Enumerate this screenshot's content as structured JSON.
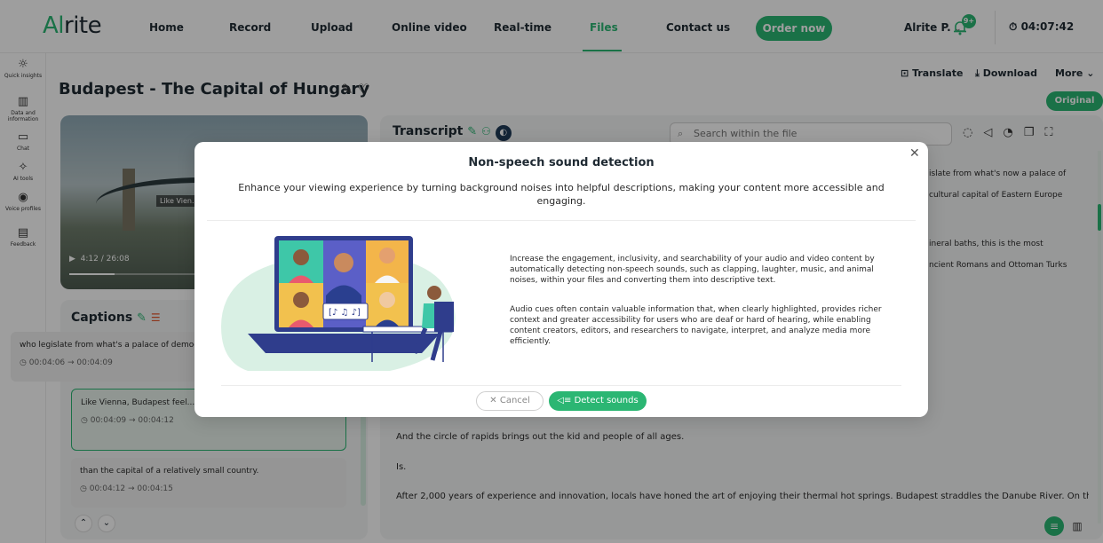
{
  "app": {
    "logo_a": "Al",
    "logo_b": "rite"
  },
  "nav": {
    "items": [
      "Home",
      "Record",
      "Upload",
      "Online video",
      "Real-time",
      "Files",
      "Contact us"
    ],
    "active": "Files",
    "order_label": "Order now",
    "user": "Alrite P.",
    "notif_count": "9+",
    "timer": "04:07:42"
  },
  "rail": [
    {
      "icon": "lightbulb-icon",
      "label": "Quick insights"
    },
    {
      "icon": "bar-chart-icon",
      "label": "Data and information"
    },
    {
      "icon": "chat-icon",
      "label": "Chat"
    },
    {
      "icon": "sparkle-icon",
      "label": "AI tools"
    },
    {
      "icon": "voice-icon",
      "label": "Voice profiles"
    },
    {
      "icon": "feedback-icon",
      "label": "Feedback"
    }
  ],
  "page": {
    "title": "Budapest - The Capital of Hungary",
    "translate": "Translate",
    "download": "Download",
    "more": "More",
    "original": "Original"
  },
  "video": {
    "overlay_text": "Like Vien... m",
    "timecode": "4:12 / 26:08",
    "progress": 0.16
  },
  "captions": {
    "title": "Captions",
    "cards": [
      {
        "text": "who legislate from what's a palace of democracy.",
        "time": "00:04:06 → 00:04:09"
      },
      {
        "text": "Like Vienna, Budapest feel... more grandiose",
        "time": "00:04:09 → 00:04:12"
      },
      {
        "text": "than the capital of a relatively small country.",
        "time": "00:04:12 → 00:04:15"
      }
    ]
  },
  "transcript": {
    "title": "Transcript",
    "search_placeholder": "Search within the file",
    "side_lines": [
      "islate from what's now a palace of",
      "cultural capital of Eastern Europe",
      "ineral baths, this is the most",
      "ncient Romans and Ottoman Turks"
    ],
    "lines": [
      "And the circle of rapids brings out the kid and people of all ages.",
      "Is.",
      "After 2,000 years of experience and innovation, locals have honed the art of enjoying their thermal hot springs. Budapest straddles the Danube River. On the"
    ]
  },
  "modal": {
    "title": "Non-speech sound detection",
    "subtitle": "Enhance your viewing experience by turning background noises into helpful descriptions, making your content more accessible and engaging.",
    "para1": "Increase the engagement, inclusivity, and searchability of your audio and video content by automatically detecting non-speech sounds, such as clapping, laughter, music, and animal noises, within your files and converting them into descriptive text.",
    "para2": "Audio cues often contain valuable information that, when clearly highlighted, provides richer context and greater accessibility for users who are deaf or hard of hearing, while enabling content creators, editors, and researchers to navigate, interpret, and analyze media more efficiently.",
    "cancel": "Cancel",
    "detect": "Detect sounds"
  },
  "colors": {
    "accent": "#2bb673",
    "text": "#1f2a33"
  }
}
